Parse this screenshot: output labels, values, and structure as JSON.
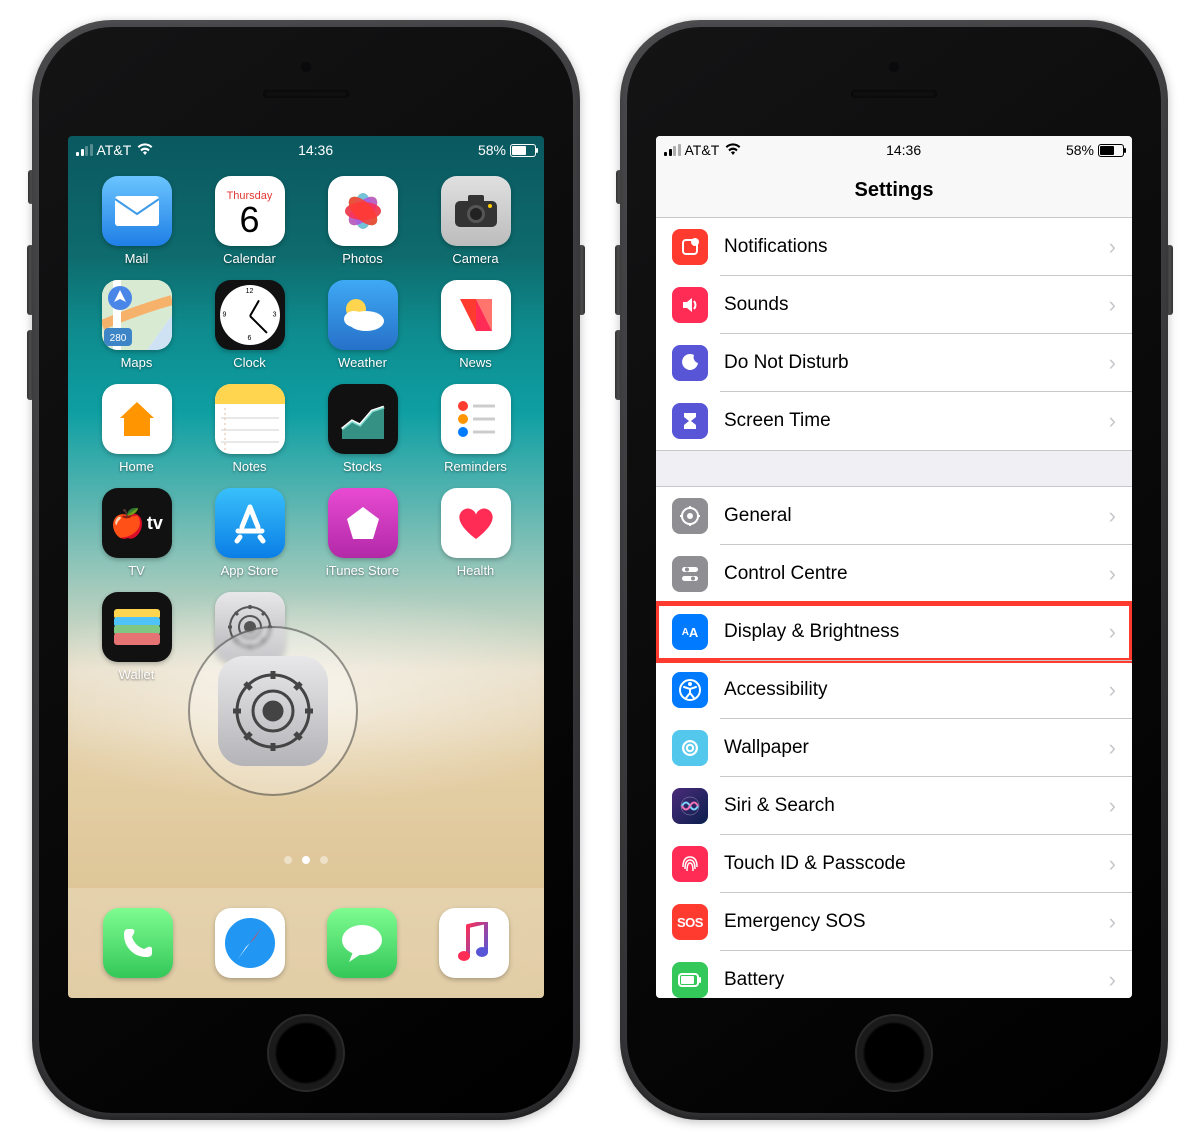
{
  "status": {
    "carrier": "AT&T",
    "time": "14:36",
    "battery_pct": "58%"
  },
  "home": {
    "calendar_day": "Thursday",
    "calendar_date": "6",
    "apps": {
      "mail": "Mail",
      "calendar": "Calendar",
      "photos": "Photos",
      "camera": "Camera",
      "maps": "Maps",
      "clock": "Clock",
      "weather": "Weather",
      "news": "News",
      "home": "Home",
      "notes": "Notes",
      "stocks": "Stocks",
      "reminders": "Reminders",
      "tv": "TV",
      "appstore": "App Store",
      "itunes": "iTunes Store",
      "health": "Health",
      "wallet": "Wallet",
      "settings": "Settings"
    }
  },
  "settings": {
    "title": "Settings",
    "rows": {
      "notifications": "Notifications",
      "sounds": "Sounds",
      "dnd": "Do Not Disturb",
      "screentime": "Screen Time",
      "general": "General",
      "control": "Control Centre",
      "display": "Display & Brightness",
      "accessibility": "Accessibility",
      "wallpaper": "Wallpaper",
      "siri": "Siri & Search",
      "touchid": "Touch ID & Passcode",
      "sos": "Emergency SOS",
      "battery": "Battery"
    },
    "sos_icon_text": "SOS",
    "display_icon_text": "AA"
  }
}
